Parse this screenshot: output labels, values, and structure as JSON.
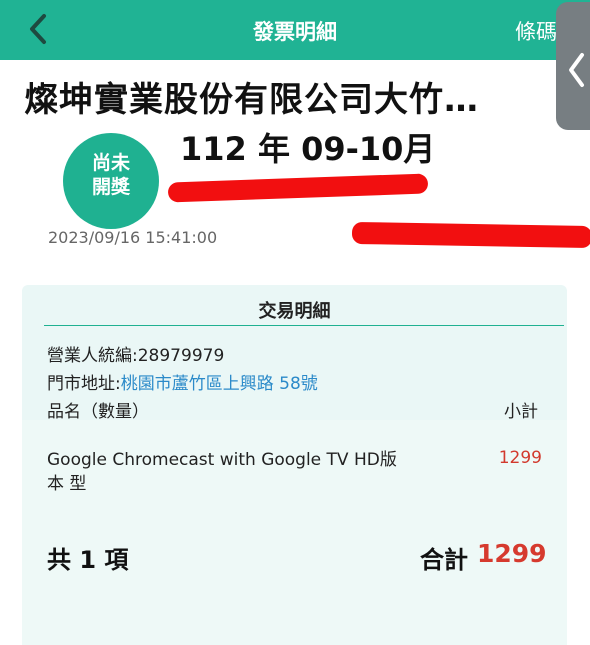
{
  "header": {
    "title": "發票明細",
    "right_label": "條碼"
  },
  "invoice": {
    "company": "燦坤實業股份有限公司大竹…",
    "period": "112 年 09-10月",
    "status": "尚未開獎",
    "datetime": "2023/09/16 15:41:00"
  },
  "details": {
    "section_title": "交易明細",
    "tax_id_label": "營業人統編:",
    "tax_id_value": "28979979",
    "address_label": "門市地址:",
    "address_value": "桃園市蘆竹區上興路 58號",
    "item_header": "品名（數量）",
    "subtotal_header": "小計",
    "items": [
      {
        "name": "Google Chromecast with Google TV HD版本 型",
        "subtotal": "1299"
      }
    ],
    "count_text": "共 1 項",
    "total_label": "合計",
    "total_value": "1299"
  },
  "colors": {
    "brand_green": "#20b394",
    "total_red": "#d63a2e",
    "link_blue": "#2b8ac9",
    "redaction_red": "#f20f10"
  },
  "icons": [
    "chevron-left-icon",
    "side-chevron-left-icon"
  ]
}
